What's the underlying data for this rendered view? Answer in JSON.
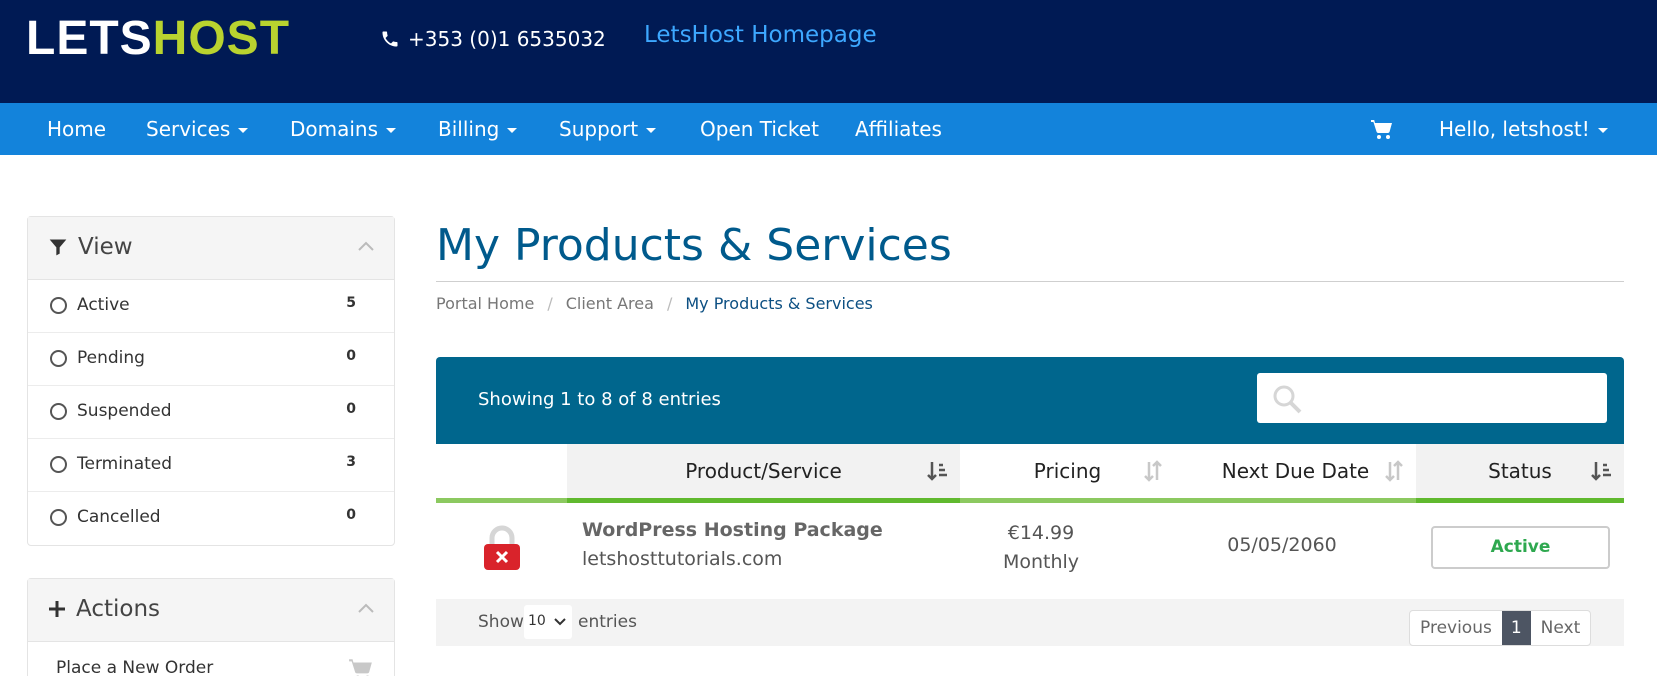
{
  "header": {
    "logo": {
      "part1": "LETS",
      "part2": "HOST"
    },
    "phone": "+353 (0)1 6535032",
    "homepage_link": "LetsHost Homepage"
  },
  "nav": {
    "items": [
      {
        "label": "Home",
        "dropdown": false
      },
      {
        "label": "Services",
        "dropdown": true
      },
      {
        "label": "Domains",
        "dropdown": true
      },
      {
        "label": "Billing",
        "dropdown": true
      },
      {
        "label": "Support",
        "dropdown": true
      },
      {
        "label": "Open Ticket",
        "dropdown": false
      },
      {
        "label": "Affiliates",
        "dropdown": false
      }
    ],
    "cart_icon": "shopping-cart-icon",
    "user_menu": "Hello, letshost!"
  },
  "sidebar": {
    "view_panel": {
      "title": "View",
      "filters": [
        {
          "label": "Active",
          "count": "5"
        },
        {
          "label": "Pending",
          "count": "0"
        },
        {
          "label": "Suspended",
          "count": "0"
        },
        {
          "label": "Terminated",
          "count": "3"
        },
        {
          "label": "Cancelled",
          "count": "0"
        }
      ]
    },
    "actions_panel": {
      "title": "Actions",
      "items": [
        {
          "label": "Place a New Order",
          "icon": "shopping-cart-icon"
        }
      ]
    }
  },
  "main": {
    "title": "My Products & Services",
    "breadcrumb": [
      {
        "label": "Portal Home"
      },
      {
        "label": "Client Area"
      },
      {
        "label": "My Products & Services"
      }
    ],
    "table": {
      "info": "Showing 1 to 8 of 8 entries",
      "search_placeholder": "",
      "columns": [
        "Product/Service",
        "Pricing",
        "Next Due Date",
        "Status"
      ],
      "rows": [
        {
          "icon": "ssl-lock-icon",
          "product": "WordPress Hosting Package",
          "domain": "letshosttutorials.com",
          "price": "€14.99",
          "cycle": "Monthly",
          "due_date": "05/05/2060",
          "status": "Active"
        }
      ],
      "footer": {
        "show_label": "Show",
        "page_size": "10",
        "entries_label": "entries",
        "previous": "Previous",
        "current_page": "1",
        "next": "Next"
      }
    }
  },
  "colors": {
    "header_bg": "#001a54",
    "nav_bg": "#1383db",
    "table_header_bg": "#00668d",
    "accent_green": "#8cc960",
    "status_active": "#2ea84f",
    "title_blue": "#005a8c"
  }
}
